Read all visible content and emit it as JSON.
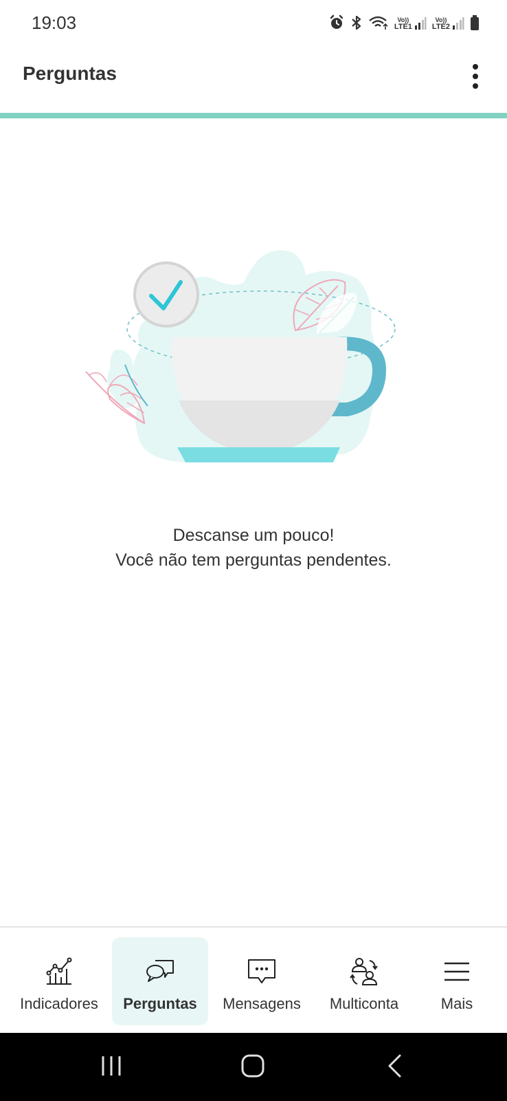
{
  "status_bar": {
    "time": "19:03",
    "sim1": "LTE1",
    "sim2": "LTE2",
    "volte": "Vo))",
    "icons": [
      "alarm-icon",
      "bluetooth-icon",
      "wifi-icon",
      "signal-icon",
      "battery-icon"
    ]
  },
  "app_bar": {
    "title": "Perguntas",
    "menu_icon": "more-vert-icon"
  },
  "colors": {
    "accent_line": "#7fd3c0",
    "active_tab_bg": "#e8f6f5",
    "illustration_blob": "#e4f7f5",
    "check": "#2ec6d6",
    "cup_handle": "#5fb7cc",
    "saucer": "#7adde2"
  },
  "empty_state": {
    "line1": "Descanse um pouco!",
    "line2": "Você não tem perguntas pendentes."
  },
  "bottom_nav": {
    "items": [
      {
        "label": "Indicadores",
        "icon": "chart-icon",
        "active": false
      },
      {
        "label": "Perguntas",
        "icon": "chat-bubbles-icon",
        "active": true
      },
      {
        "label": "Mensagens",
        "icon": "message-icon",
        "active": false
      },
      {
        "label": "Multiconta",
        "icon": "users-icon",
        "active": false
      },
      {
        "label": "Mais",
        "icon": "hamburger-icon",
        "active": false
      }
    ]
  },
  "system_nav": {
    "icons": [
      "recents-icon",
      "home-icon",
      "back-icon"
    ]
  }
}
